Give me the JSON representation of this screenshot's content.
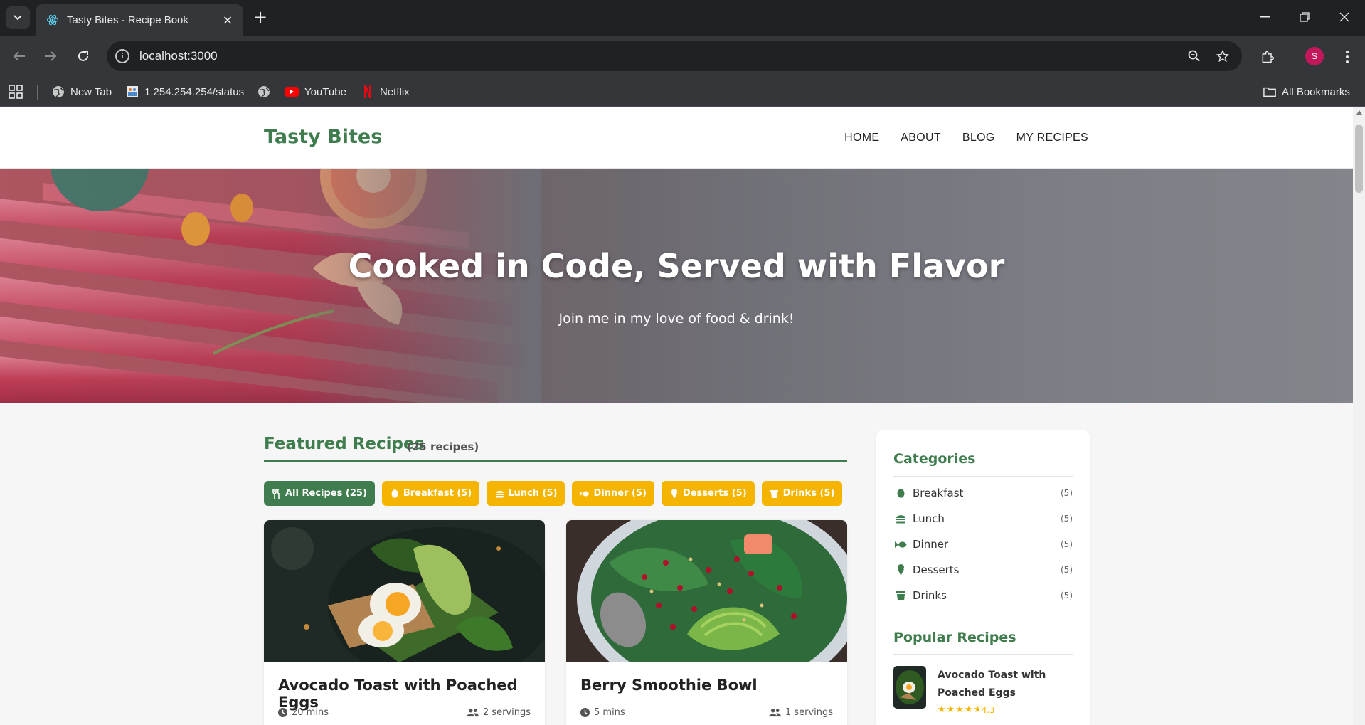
{
  "browser": {
    "tab_title": "Tasty Bites - Recipe Book",
    "url": "localhost:3000",
    "bookmarks": [
      {
        "label": "New Tab",
        "icon": "globe-icon"
      },
      {
        "label": "1.254.254.254/status",
        "icon": "router-icon"
      },
      {
        "label": "",
        "icon": "globe-icon"
      },
      {
        "label": "YouTube",
        "icon": "youtube-icon"
      },
      {
        "label": "Netflix",
        "icon": "netflix-icon"
      }
    ],
    "all_bookmarks_label": "All Bookmarks",
    "profile_initial": "S"
  },
  "site": {
    "logo": "Tasty Bites",
    "nav": [
      "HOME",
      "ABOUT",
      "BLOG",
      "MY RECIPES"
    ]
  },
  "hero": {
    "title": "Cooked in Code, Served with Flavor",
    "subtitle": "Join me in my love of food & drink!"
  },
  "featured": {
    "title": "Featured Recipes",
    "count_label": "(25 recipes)",
    "filters": [
      {
        "label": "All Recipes (25)",
        "icon": "utensils-icon",
        "active": true
      },
      {
        "label": "Breakfast (5)",
        "icon": "egg-icon",
        "active": false
      },
      {
        "label": "Lunch (5)",
        "icon": "burger-icon",
        "active": false
      },
      {
        "label": "Dinner (5)",
        "icon": "fish-icon",
        "active": false
      },
      {
        "label": "Desserts (5)",
        "icon": "ice-cream-icon",
        "active": false
      },
      {
        "label": "Drinks (5)",
        "icon": "mug-icon",
        "active": false
      }
    ],
    "cards": [
      {
        "title": "Avocado Toast with Poached Eggs",
        "time": "20 mins",
        "servings": "2 servings"
      },
      {
        "title": "Berry Smoothie Bowl",
        "time": "5 mins",
        "servings": "1 servings"
      }
    ]
  },
  "sidebar": {
    "categories_title": "Categories",
    "categories": [
      {
        "label": "Breakfast",
        "count": "(5)",
        "icon": "egg-icon"
      },
      {
        "label": "Lunch",
        "count": "(5)",
        "icon": "burger-icon"
      },
      {
        "label": "Dinner",
        "count": "(5)",
        "icon": "fish-icon"
      },
      {
        "label": "Desserts",
        "count": "(5)",
        "icon": "ice-cream-icon"
      },
      {
        "label": "Drinks",
        "count": "(5)",
        "icon": "mug-icon"
      }
    ],
    "popular_title": "Popular Recipes",
    "popular": [
      {
        "title": "Avocado Toast with Poached Eggs",
        "rating": "4.3",
        "stars": 4.3
      }
    ]
  },
  "colors": {
    "brand_green": "#3f7d4e",
    "accent_yellow": "#f5b400"
  }
}
